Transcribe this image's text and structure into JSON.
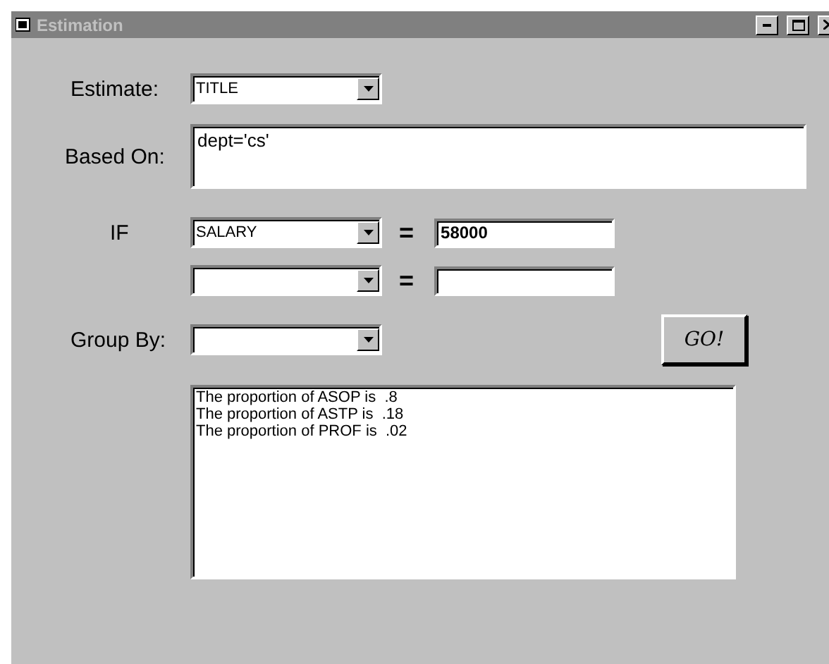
{
  "window": {
    "title": "Estimation"
  },
  "estimate": {
    "label": "Estimate:",
    "value": "TITLE"
  },
  "based_on": {
    "label": "Based On:",
    "value": "dept='cs'"
  },
  "conditions": [
    {
      "label": "IF",
      "field": "SALARY",
      "operator": "=",
      "value": "58000"
    },
    {
      "operator": "="
    }
  ],
  "group_by": {
    "label": "Group By:"
  },
  "go_button": "GO!",
  "results": [
    "The proportion of ASOP is  .8",
    "The proportion of ASTP is  .18",
    "The proportion of PROF is  .02"
  ]
}
